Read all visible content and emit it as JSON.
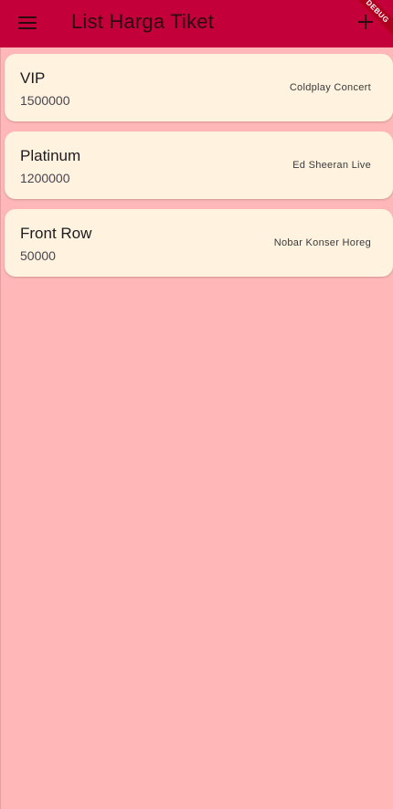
{
  "colors": {
    "appbar_bg": "#C4003A",
    "page_bg": "#FFB7B7",
    "card_bg": "#FFF3E0",
    "debug_banner": "#B00020"
  },
  "appbar": {
    "title": "List Harga Tiket",
    "menu_icon": "menu-icon",
    "add_icon": "add-icon"
  },
  "debug_banner": {
    "label": "DEBUG"
  },
  "tickets": [
    {
      "name": "VIP",
      "price": "1500000",
      "event": "Coldplay Concert"
    },
    {
      "name": "Platinum",
      "price": "1200000",
      "event": "Ed Sheeran Live"
    },
    {
      "name": "Front Row",
      "price": "50000",
      "event": "Nobar Konser Horeg"
    }
  ]
}
